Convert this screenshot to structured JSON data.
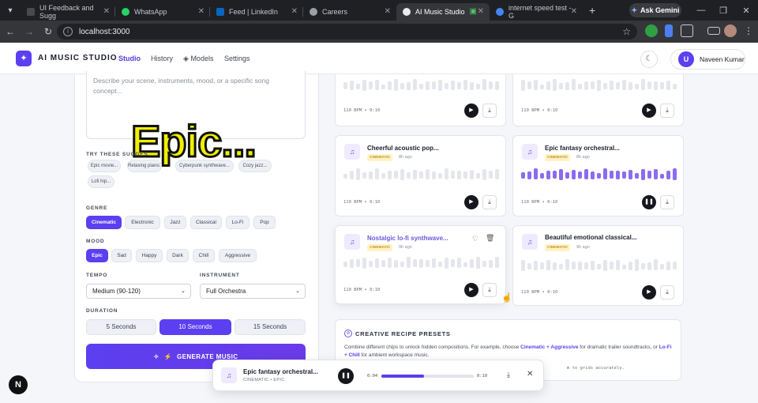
{
  "browser": {
    "tabs": [
      {
        "title": "UI Feedback and Sugg",
        "fav": "#4a4a4a"
      },
      {
        "title": "WhatsApp",
        "fav": "#25d366"
      },
      {
        "title": "Feed | LinkedIn",
        "fav": "#0a66c2"
      },
      {
        "title": "Careers",
        "fav": "#9aa0a6"
      },
      {
        "title": "AI Music Studio",
        "fav": "#e8eaed"
      },
      {
        "title": "internet speed test - G",
        "fav": "#4285f4"
      }
    ],
    "gemini_label": "Ask Gemini",
    "url": "localhost:3000"
  },
  "app": {
    "brand": "AI MUSIC STUDIO",
    "nav": [
      "Studio",
      "History",
      "Models",
      "Settings"
    ],
    "user_initial": "U",
    "user_name": "Naveen Kumar"
  },
  "composer": {
    "placeholder": "Describe your scene, instruments, mood, or a specific song concept...",
    "overlay_caption": "Epic...",
    "suggest_label": "TRY THESE SUGGES",
    "suggestions": [
      "Epic movie...",
      "Relaxing piano...",
      "Cyberpunk synthwave...",
      "Cozy jazz...",
      "Lofi hip..."
    ],
    "genre_label": "GENRE",
    "genres": [
      "Cinematic",
      "Electronic",
      "Jazz",
      "Classical",
      "Lo-Fi",
      "Pop"
    ],
    "genre_selected": "Cinematic",
    "mood_label": "MOOD",
    "moods": [
      "Epic",
      "Sad",
      "Happy",
      "Dark",
      "Chill",
      "Aggressive"
    ],
    "mood_selected": "Epic",
    "tempo_label": "TEMPO",
    "tempo_value": "Medium (90-120)",
    "instrument_label": "INSTRUMENT",
    "instrument_value": "Full Orchestra",
    "duration_label": "DURATION",
    "durations": [
      "5 Seconds",
      "10 Seconds",
      "15 Seconds"
    ],
    "duration_selected": "10 Seconds",
    "generate_label": "GENERATE MUSIC"
  },
  "tracks": [
    {
      "title": "",
      "tag": "",
      "ago": "",
      "meta": "110 BPM • 0:10",
      "playing": false
    },
    {
      "title": "",
      "tag": "",
      "ago": "",
      "meta": "110 BPM • 0:10",
      "playing": false
    },
    {
      "title": "Cheerful acoustic pop...",
      "tag": "CINEMATIC",
      "ago": "8h ago",
      "meta": "110 BPM • 0:10",
      "playing": false
    },
    {
      "title": "Epic fantasy orchestral...",
      "tag": "CINEMATIC",
      "ago": "8h ago",
      "meta": "110 BPM • 0:10",
      "playing": true
    },
    {
      "title": "Nostalgic lo-fi synthwave...",
      "tag": "CINEMATIC",
      "ago": "9h ago",
      "meta": "110 BPM • 0:10",
      "playing": false
    },
    {
      "title": "Beautiful emotional classical...",
      "tag": "CINEMATIC",
      "ago": "9h ago",
      "meta": "110 BPM • 0:10",
      "playing": false
    }
  ],
  "presets": {
    "title": "CREATIVE RECIPE PRESETS",
    "desc_a": "Combine different chips to unlock hidden compositions. For example, choose ",
    "desc_b": "Cinematic + Aggressive",
    "desc_c": " for dramatic trailer soundtracks, or ",
    "desc_d": "Lo-Fi + Chill",
    "desc_e": " for ambient workspace music.",
    "tail": "m to grids accurately."
  },
  "player": {
    "title": "Epic fantasy orchestral...",
    "subtitle": "CINEMATIC • EPIC",
    "current": "0:04",
    "total": "0:10",
    "progress": 0.46
  },
  "colors": {
    "accent": "#5b3ff0",
    "tag_bg": "#fff3c8",
    "tag_fg": "#c4921a"
  }
}
